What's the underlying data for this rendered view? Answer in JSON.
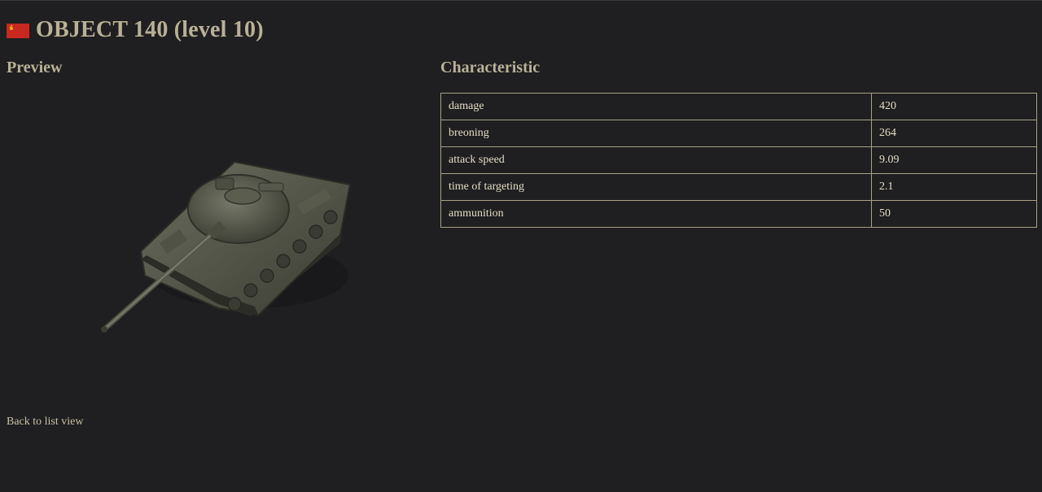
{
  "header": {
    "flag_icon": "ussr-flag-icon",
    "title": "OBJECT 140 (level 10)"
  },
  "preview": {
    "heading": "Preview",
    "image_icon": "tank-image"
  },
  "characteristic": {
    "heading": "Characteristic",
    "rows": [
      {
        "name": "damage",
        "value": "420"
      },
      {
        "name": "breoning",
        "value": "264"
      },
      {
        "name": "attack speed",
        "value": "9.09"
      },
      {
        "name": "time of targeting",
        "value": "2.1"
      },
      {
        "name": "ammunition",
        "value": "50"
      }
    ]
  },
  "footer": {
    "back_link": "Back to list view"
  },
  "colors": {
    "background": "#1f1f21",
    "heading_text": "#b9b197",
    "table_border": "#a8a088",
    "flag_red": "#c8281f",
    "flag_gold": "#f2c21b"
  }
}
